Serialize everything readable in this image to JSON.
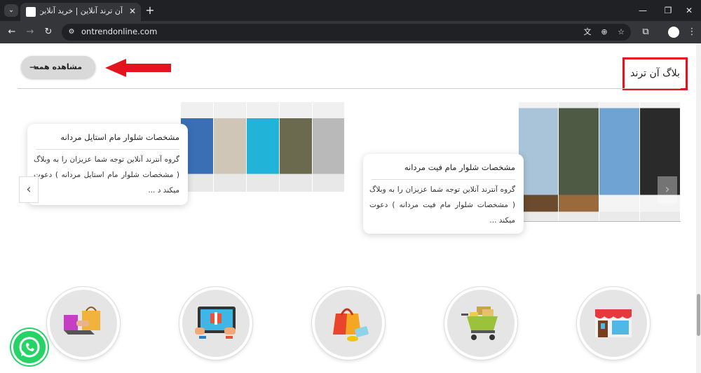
{
  "browser": {
    "tab_title": "آن ترند آنلاین | خرید آنلاین کالا از ...",
    "tab_close_icon": "close-icon",
    "new_tab_icon": "plus-icon",
    "url": "ontrendonline.com",
    "window_controls": {
      "minimize": "—",
      "restore": "❐",
      "close": "✕"
    }
  },
  "blog": {
    "section_title": "بلاگ آن ترند",
    "view_all_label": "مشاهده همه",
    "view_all_arrow": "→",
    "accent_color": "#e4141e"
  },
  "cards": [
    {
      "title": "مشخصات شلوار مام استایل مردانه",
      "excerpt": "گروه آنترند آنلاین توجه شما عزیزان را به وبلاگ ( مشخصات شلوار مام استایل مردانه ) دعوت میکند د ..."
    },
    {
      "title": "مشخصات شلوار مام فیت مردانه",
      "excerpt": "گروه آنترند آنلاین توجه شما عزیزان را به وبلاگ ( مشخصات شلوار مام فیت مردانه ) دعوت میکند ..."
    }
  ],
  "slider": {
    "prev_icon": "‹",
    "next_icon": "›"
  },
  "icons": [
    "shopping-bag-hand-icon",
    "tablet-shopping-icon",
    "shopping-bag-coin-icon",
    "shopping-cart-icon",
    "storefront-icon"
  ],
  "whatsapp": {
    "icon": "whatsapp-icon",
    "color": "#25d366"
  }
}
